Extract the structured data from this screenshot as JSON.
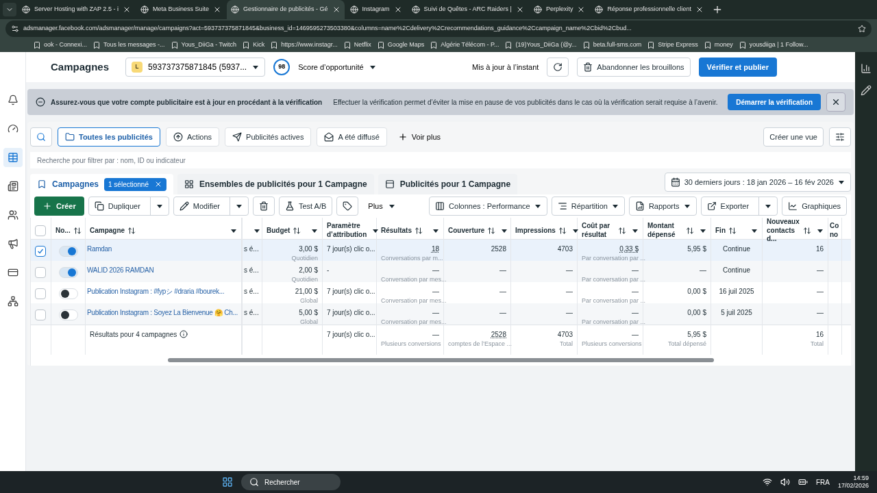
{
  "browser": {
    "tabs": [
      {
        "title": "Server Hosting with ZAP 2.5 - i",
        "selected": false
      },
      {
        "title": "Meta Business Suite",
        "selected": false
      },
      {
        "title": "Gestionnaire de publicités - Gé",
        "selected": true
      },
      {
        "title": "Instagram",
        "selected": false
      },
      {
        "title": "Suivi de Quêtes - ARC Raiders |",
        "selected": false
      },
      {
        "title": "Perplexity",
        "selected": false
      },
      {
        "title": "Réponse professionnelle client",
        "selected": false
      }
    ],
    "url": "adsmanager.facebook.com/adsmanager/manage/campaigns?act=593737375871845&business_id=1469595273503380&columns=name%2Cdelivery%2Crecommendations_guidance%2Ccampaign_name%2Cbid%2Cbud...",
    "bookmarks": [
      "ook - Connexi...",
      "Tous les messages -...",
      "Yous_DiiGa - Twitch",
      "Kick",
      "https://www.instagr...",
      "Netflix",
      "Google Maps",
      "Algérie Télécom - P...",
      "(19)Yous_DiiGa (@y...",
      "beta.full-sms.com",
      "Stripe Express",
      "money",
      "yousdiiga | 1 Follow..."
    ]
  },
  "header": {
    "title": "Campagnes",
    "account_initial": "L",
    "account": "593737375871845 (5937...",
    "score": "98",
    "score_label": "Score d’opportunité",
    "status": "Mis à jour à l’instant",
    "discard": "Abandonner les brouillons",
    "publish": "Vérifier et publier"
  },
  "banner": {
    "title": "Assurez-vous que votre compte publicitaire est à jour en procédant à la vérification",
    "text": "Effectuer la vérification permet d’éviter la mise en pause de vos publicités dans le cas où la vérification serait requise à l’avenir.",
    "action": "Démarrer la vérification"
  },
  "filters": [
    {
      "label": "Toutes les publicités",
      "selected": true
    },
    {
      "label": "Actions",
      "selected": false
    },
    {
      "label": "Publicités actives",
      "selected": false
    },
    {
      "label": "A été diffusé",
      "selected": false
    }
  ],
  "more_filters": "Voir plus",
  "create_view": "Créer une vue",
  "search": {
    "placeholder": "Recherche pour filtrer par : nom, ID ou indicateur"
  },
  "level_tabs": [
    {
      "label": "Campagnes",
      "badge": "1 sélectionné",
      "selected": true
    },
    {
      "label": "Ensembles de publicités pour 1 Campagne",
      "selected": false
    },
    {
      "label": "Publicités pour 1 Campagne",
      "selected": false
    }
  ],
  "date_range": "30 derniers jours : 18 jan 2026 – 16 fév 2026",
  "toolbar": {
    "create": "Créer",
    "duplicate": "Dupliquer",
    "edit": "Modifier",
    "ab_test": "Test A/B",
    "more": "Plus",
    "columns": "Colonnes : Performance",
    "breakdown": "Répartition",
    "reports": "Rapports",
    "export": "Exporter",
    "charts": "Graphiques"
  },
  "table": {
    "all_selected": false,
    "columns": [
      {
        "label": "No...",
        "sortable": true,
        "menu": false
      },
      {
        "label": "Campagne",
        "sortable": true,
        "menu": true
      },
      {
        "sortable": false,
        "menu": true
      },
      {
        "label": "Budget",
        "sortable": true,
        "menu": true
      },
      {
        "label": "Paramètre d’attribution",
        "sortable": false,
        "menu": true
      },
      {
        "label": "Résultats",
        "sortable": true,
        "menu": true
      },
      {
        "label": "Couverture",
        "sortable": true,
        "menu": true
      },
      {
        "label": "Impressions",
        "sortable": true,
        "menu": true
      },
      {
        "label": "Coût par résultat",
        "sortable": true,
        "menu": true
      },
      {
        "label": "Montant dépensé",
        "sortable": true,
        "menu": true
      },
      {
        "label": "Fin",
        "sortable": true,
        "menu": true
      },
      {
        "label": "Nouveaux contacts d...",
        "sortable": true,
        "menu": true
      },
      {
        "label": "Co no",
        "sortable": false,
        "menu": false
      }
    ],
    "rows": [
      {
        "selected": true,
        "on": true,
        "name": "Ramdan",
        "column_3": "s é...",
        "budget": "3,00 $",
        "budget_type": "Quotidien",
        "attribution": "7 jour(s) clic o...",
        "results": "18",
        "results_note": "Conversations par m...",
        "underlined": true,
        "reach": "2528",
        "impressions": "4703",
        "cost": "0,33 $",
        "cost_note": "Par conversation par ...",
        "spent": "5,95 $",
        "end": "Continue",
        "contacts": "16"
      },
      {
        "selected": false,
        "on": true,
        "name": "WALID 2026 RAMDAN",
        "column_3": "s é...",
        "budget": "2,00 $",
        "budget_type": "Quotidien",
        "attribution": "-",
        "results": "—",
        "results_note": "Conversation par mes...",
        "underlined": false,
        "reach": "—",
        "impressions": "—",
        "cost": "—",
        "cost_note": "Par conversation par ...",
        "spent": "—",
        "end": "Continue",
        "contacts": "—"
      },
      {
        "selected": false,
        "on": false,
        "name": "Publication Instagram : #fypシ #draria #bourek...",
        "column_3": "s é...",
        "budget": "21,00 $",
        "budget_type": "Global",
        "attribution": "7 jour(s) clic o...",
        "results": "—",
        "results_note": "Conversation par mes...",
        "underlined": false,
        "reach": "—",
        "impressions": "—",
        "cost": "—",
        "cost_note": "Par conversation par ...",
        "spent": "0,00 $",
        "end": "16 juil 2025",
        "contacts": "—"
      },
      {
        "selected": false,
        "on": false,
        "name": "Publication Instagram : Soyez La Bienvenue 🤗 Ch...",
        "column_3": "s é...",
        "budget": "5,00 $",
        "budget_type": "Global",
        "attribution": "7 jour(s) clic o...",
        "results": "—",
        "results_note": "Conversation par mes...",
        "underlined": false,
        "reach": "—",
        "impressions": "—",
        "cost": "—",
        "cost_note": "Par conversation par ...",
        "spent": "0,00 $",
        "end": "5 juil 2025",
        "contacts": "—"
      }
    ],
    "totals": {
      "label": "Résultats pour 4 campagnes",
      "attribution": "7 jour(s) clic o...",
      "results": "—",
      "results_note": "Plusieurs conversions",
      "reach": "2528",
      "reach_note": "comptes de l’Espace ...",
      "impressions": "4703",
      "impressions_note": "Total",
      "cost": "—",
      "cost_note": "Plusieurs conversions",
      "spent": "5,95 $",
      "spent_note": "Total dépensé",
      "contacts": "16",
      "contacts_note": "Total"
    }
  },
  "taskbar": {
    "search": "Rechercher",
    "language": "FRA",
    "time": "14:59",
    "date": "17/02/2026"
  }
}
